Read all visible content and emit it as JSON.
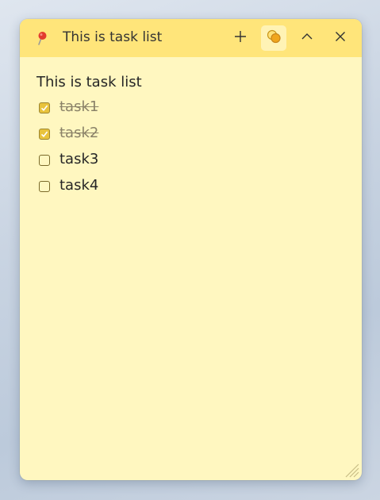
{
  "note": {
    "title": "This is task list",
    "body_title": "This is task list",
    "colors": {
      "background": "#fff7c0",
      "titlebar": "#ffe57a",
      "checkbox_checked": "#e8c33c"
    },
    "icons": {
      "pin": "pushpin-icon",
      "new": "plus-icon",
      "color": "color-palette-icon",
      "collapse": "chevron-up-icon",
      "close": "close-icon"
    },
    "tasks": [
      {
        "label": "task1",
        "checked": true
      },
      {
        "label": "task2",
        "checked": true
      },
      {
        "label": "task3",
        "checked": false
      },
      {
        "label": "task4",
        "checked": false
      }
    ]
  }
}
